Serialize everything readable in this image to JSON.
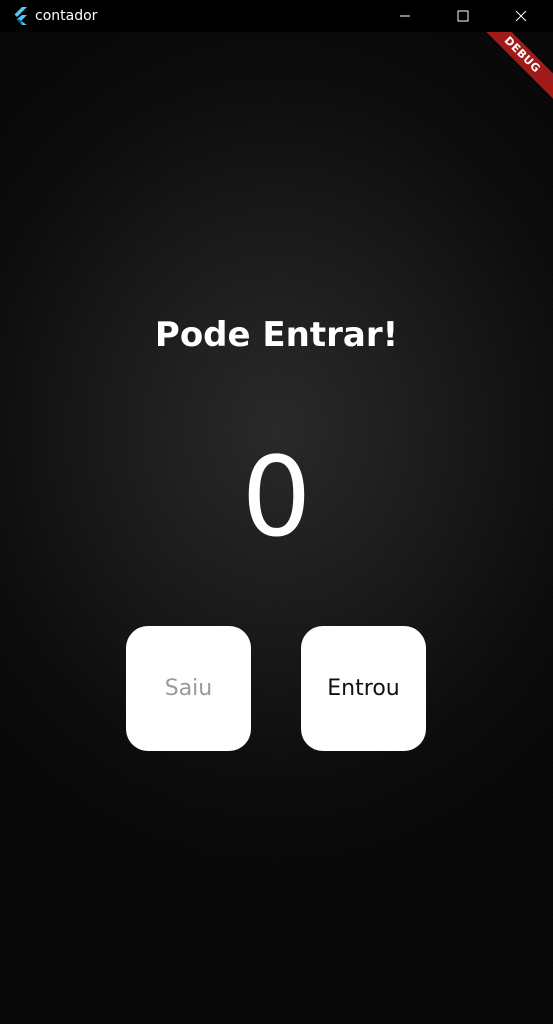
{
  "window": {
    "title": "contador",
    "icon": "flutter-logo-icon",
    "controls": {
      "minimize_icon": "minimize-icon",
      "maximize_icon": "maximize-icon",
      "close_icon": "close-icon"
    }
  },
  "debug_banner": {
    "label": "DEBUG",
    "color": "#a11a1a"
  },
  "main": {
    "status_text": "Pode Entrar!",
    "count": "0",
    "buttons": {
      "exit_label": "Saiu",
      "enter_label": "Entrou"
    }
  },
  "colors": {
    "background": "#1a1a1a",
    "button_bg": "#ffffff",
    "exit_text": "#9a9a9a",
    "enter_text": "#111111"
  }
}
